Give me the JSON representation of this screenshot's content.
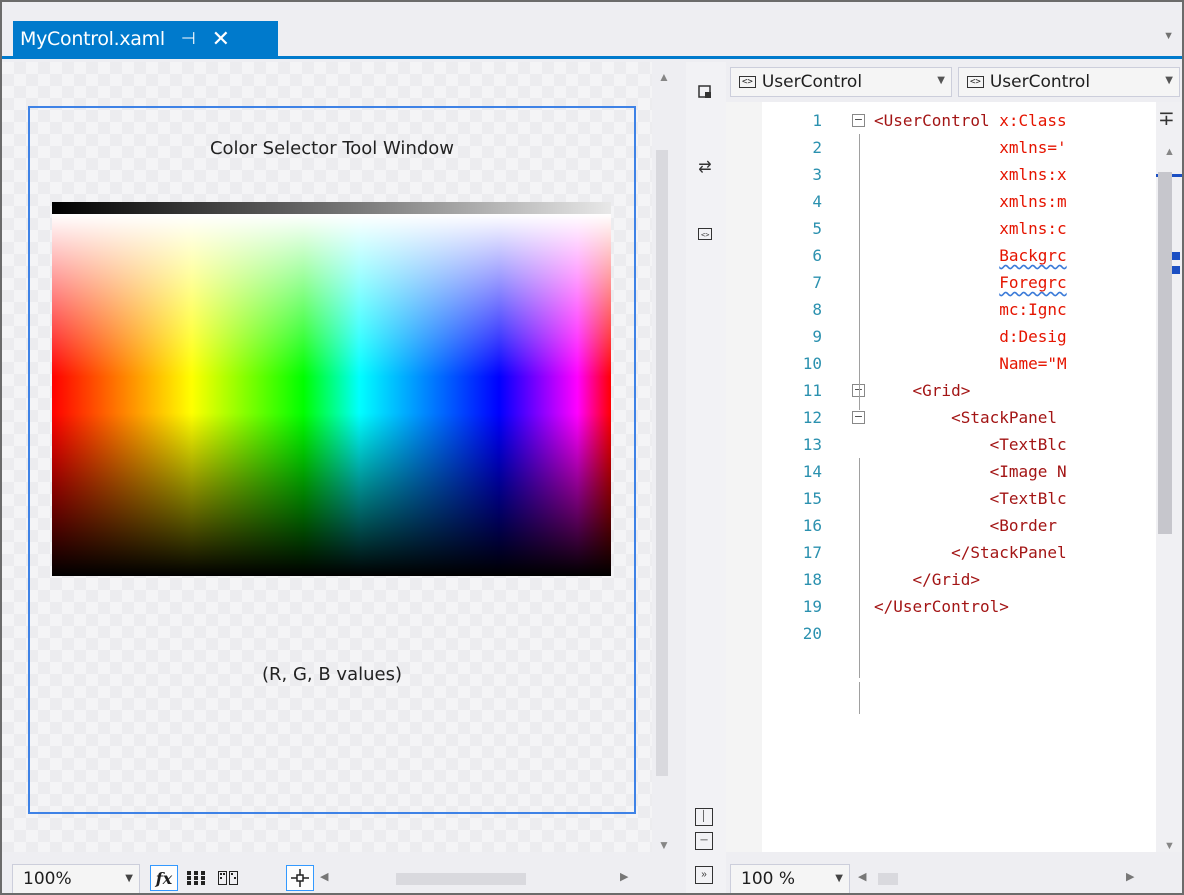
{
  "tab": {
    "title": "MyControl.xaml",
    "pin": "⊣",
    "close": "✕"
  },
  "designer": {
    "window_title": "Color Selector Tool Window",
    "values_label": "(R, G, B values)",
    "zoom": "100%"
  },
  "editor": {
    "type_dropdown": "UserControl",
    "member_dropdown": "UserControl",
    "zoom": "100 %",
    "lines": [
      {
        "n": "1",
        "parts": [
          [
            "red",
            "<UserControl "
          ],
          [
            "attr",
            "x:Class"
          ]
        ]
      },
      {
        "n": "2",
        "parts": [
          [
            "pad",
            "             "
          ],
          [
            "attr",
            "xmlns='"
          ]
        ]
      },
      {
        "n": "3",
        "parts": [
          [
            "pad",
            "             "
          ],
          [
            "attr",
            "xmlns:x"
          ]
        ]
      },
      {
        "n": "4",
        "parts": [
          [
            "pad",
            "             "
          ],
          [
            "attr",
            "xmlns:m"
          ]
        ]
      },
      {
        "n": "5",
        "parts": [
          [
            "pad",
            "             "
          ],
          [
            "attr",
            "xmlns:c"
          ]
        ]
      },
      {
        "n": "6",
        "parts": [
          [
            "pad",
            "             "
          ],
          [
            "wavy",
            "Backgrc"
          ]
        ]
      },
      {
        "n": "7",
        "parts": [
          [
            "pad",
            "             "
          ],
          [
            "wavy",
            "Foregrc"
          ]
        ]
      },
      {
        "n": "8",
        "parts": [
          [
            "pad",
            "             "
          ],
          [
            "attr",
            "mc:Ignc"
          ]
        ]
      },
      {
        "n": "9",
        "parts": [
          [
            "pad",
            "             "
          ],
          [
            "attr",
            "d:Desig"
          ]
        ]
      },
      {
        "n": "10",
        "parts": [
          [
            "pad",
            "             "
          ],
          [
            "attr",
            "Name=\"M"
          ]
        ]
      },
      {
        "n": "11",
        "parts": [
          [
            "pad",
            "    "
          ],
          [
            "red",
            "<Grid>"
          ]
        ]
      },
      {
        "n": "12",
        "parts": [
          [
            "pad",
            "        "
          ],
          [
            "red",
            "<StackPanel"
          ]
        ]
      },
      {
        "n": "13",
        "parts": [
          [
            "pad",
            "            "
          ],
          [
            "red",
            "<TextBlc"
          ]
        ]
      },
      {
        "n": "14",
        "parts": [
          [
            "pad",
            "            "
          ],
          [
            "red",
            "<Image N"
          ]
        ]
      },
      {
        "n": "15",
        "parts": [
          [
            "pad",
            "            "
          ],
          [
            "red",
            "<TextBlc"
          ]
        ]
      },
      {
        "n": "16",
        "parts": [
          [
            "pad",
            "            "
          ],
          [
            "red",
            "<Border "
          ]
        ]
      },
      {
        "n": "17",
        "parts": [
          [
            "pad",
            "        "
          ],
          [
            "red",
            "</StackPanel"
          ]
        ]
      },
      {
        "n": "18",
        "parts": [
          [
            "pad",
            "    "
          ],
          [
            "red",
            "</Grid>"
          ]
        ]
      },
      {
        "n": "19",
        "parts": [
          [
            "red",
            "</UserControl>"
          ]
        ]
      },
      {
        "n": "20",
        "parts": []
      }
    ]
  },
  "toolbar": {
    "fx_label": "fx"
  },
  "colors": {
    "accent": "#007acc",
    "selection": "#3e82e6",
    "xml_tag": "#a31515",
    "xml_attr": "#e51400",
    "line_number": "#2b91af"
  },
  "icons": [
    "pin-icon",
    "close-icon",
    "tab-dropdown-icon",
    "swap-panes-icon",
    "collapse-pane-icon",
    "vertical-split-icon",
    "horizontal-split-icon",
    "expand-pane-icon",
    "grid-icon",
    "snap-grid-icon",
    "snap-lines-icon",
    "xaml-tag-icon"
  ]
}
